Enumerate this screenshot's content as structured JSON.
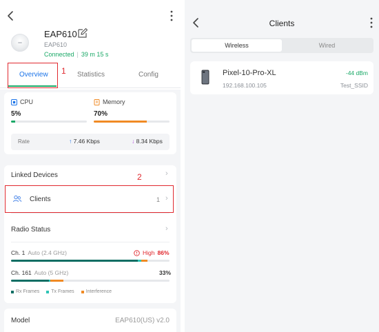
{
  "left": {
    "device": {
      "name": "EAP610",
      "model": "EAP610",
      "status": "Connected",
      "uptime": "39 m 15 s"
    },
    "tabs": [
      {
        "label": "Overview",
        "active": true
      },
      {
        "label": "Statistics",
        "active": false
      },
      {
        "label": "Config",
        "active": false
      }
    ],
    "callouts": [
      "1",
      "2"
    ],
    "cpu": {
      "label": "CPU",
      "value": "5%",
      "fraction": 0.05,
      "color": "#19a866"
    },
    "memory": {
      "label": "Memory",
      "value": "70%",
      "fraction": 0.7,
      "color": "#f08a24"
    },
    "rate": {
      "label": "Rate",
      "up": "7.46 Kbps",
      "down": "8.34 Kbps",
      "up_arrow": "↑",
      "down_arrow": "↓"
    },
    "linked_devices": {
      "label": "Linked Devices"
    },
    "clients": {
      "label": "Clients",
      "count": "1"
    },
    "radio_status": {
      "label": "Radio Status",
      "channels": [
        {
          "channel": "Ch. 1",
          "band": "Auto (2.4 GHz)",
          "warning": "High",
          "percent": "86%",
          "rx": 0.8,
          "tx": 0.02,
          "interference": 0.04
        },
        {
          "channel": "Ch. 161",
          "band": "Auto (5 GHz)",
          "warning": "",
          "percent": "33%",
          "rx": 0.24,
          "tx": 0.01,
          "interference": 0.08
        }
      ],
      "legend": [
        "Rx Frames",
        "Tx Frames",
        "Interference"
      ]
    },
    "model": {
      "label": "Model",
      "value": "EAP610(US) v2.0"
    },
    "colors": {
      "rx": "#0f6e64",
      "tx": "#2ec4b6",
      "interference": "#f08a24",
      "accent_green": "#19a866",
      "alert_red": "#e0282e"
    }
  },
  "right": {
    "title": "Clients",
    "segments": [
      {
        "label": "Wireless",
        "active": true
      },
      {
        "label": "Wired",
        "active": false
      }
    ],
    "client": {
      "name": "Pixel-10-Pro-XL",
      "ip": "192.168.100.105",
      "signal": "-44 dBm",
      "ssid": "Test_SSID"
    }
  },
  "icons": [
    "back-icon",
    "more-icon",
    "edit-icon",
    "cpu-icon",
    "memory-icon",
    "chevron-right-icon",
    "clients-icon",
    "warning-icon",
    "phone-icon"
  ]
}
